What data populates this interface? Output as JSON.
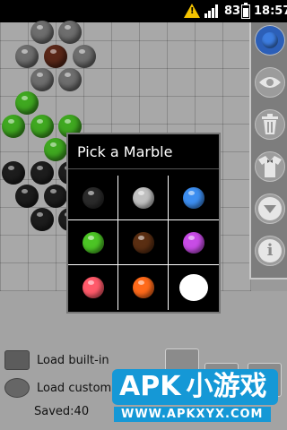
{
  "status_bar": {
    "battery_level": "83",
    "time": "18:57",
    "warning_icon": "warning-icon",
    "signal_icon": "signal-icon",
    "battery_icon": "battery-icon"
  },
  "dialog": {
    "title": "Pick a Marble",
    "marbles": [
      {
        "name": "black",
        "color": "#2a2a2a"
      },
      {
        "name": "gray",
        "color": "#c0c0c0"
      },
      {
        "name": "blue",
        "color": "#3d8ef0"
      },
      {
        "name": "green",
        "color": "#4cc425"
      },
      {
        "name": "brown",
        "color": "#5a2e12"
      },
      {
        "name": "purple",
        "color": "#c84ce6"
      },
      {
        "name": "red",
        "color": "#ff5a6a"
      },
      {
        "name": "orange",
        "color": "#ff6a1a"
      },
      {
        "name": "empty",
        "color": "#ffffff"
      }
    ]
  },
  "board_marbles": [
    {
      "color": "#6e6e6e"
    },
    {
      "color": "#6e6e6e"
    },
    {
      "color": "#6e6e6e"
    },
    {
      "color": "#5a2718"
    },
    {
      "color": "#6e6e6e"
    },
    {
      "color": "#6e6e6e"
    },
    {
      "color": "#6e6e6e"
    },
    {
      "color": "#3fa820"
    },
    {
      "color": "#3fa820"
    },
    {
      "color": "#3fa820"
    },
    {
      "color": "#3fa820"
    },
    {
      "color": "#3fa820"
    },
    {
      "color": "#1d1d1d"
    },
    {
      "color": "#1d1d1d"
    },
    {
      "color": "#1d1d1d"
    },
    {
      "color": "#1d1d1d"
    },
    {
      "color": "#1d1d1d"
    },
    {
      "color": "#1d1d1d"
    },
    {
      "color": "#1d1d1d"
    },
    {
      "color": "#1d1d1d"
    }
  ],
  "toolbar": {
    "icons": [
      "blue-marble-icon",
      "eye-icon",
      "trash-icon",
      "tuxedo-icon",
      "chevron-down-icon",
      "info-icon"
    ]
  },
  "lower": {
    "load_builtin": "Load built-in",
    "load_custom": "Load custom",
    "saved": "Saved:40"
  },
  "watermark": {
    "logo": "APK",
    "logo_cn": "小游戏",
    "url": "WWW.APKXYX.COM"
  },
  "colors": {
    "accent_blue": "#2c5fb8",
    "watermark_blue": "#1598d6"
  }
}
